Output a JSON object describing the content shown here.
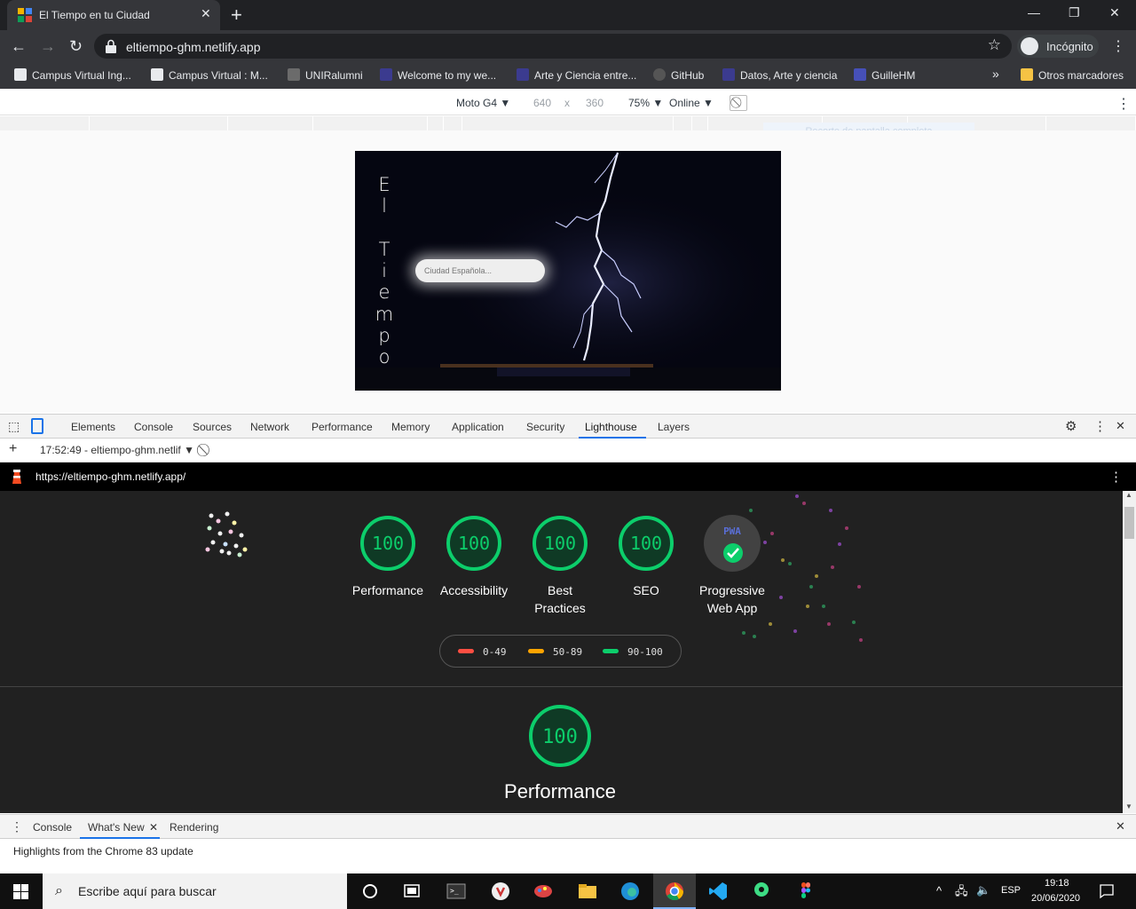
{
  "browser": {
    "tab_title": "El Tiempo en tu Ciudad",
    "url": "eltiempo-ghm.netlify.app",
    "profile_label": "Incógnito",
    "bookmarks": [
      "Campus Virtual Ing...",
      "Campus Virtual : M...",
      "UNIRalumni",
      "Welcome to my we...",
      "Arte y Ciencia entre...",
      "GitHub",
      "Datos, Arte y ciencia",
      "GuilleHM"
    ],
    "other_bookmarks": "Otros marcadores",
    "more_bookmarks": "»"
  },
  "device_toolbar": {
    "device": "Moto G4",
    "width": "640",
    "times": "x",
    "height": "360",
    "zoom": "75%",
    "network": "Online",
    "capture_tooltip": "Recorte de pantalla completa"
  },
  "site": {
    "title_letters": [
      "E",
      "l",
      "",
      "T",
      "i",
      "e",
      "m",
      "p",
      "o"
    ],
    "city_placeholder": "Ciudad Española..."
  },
  "devtools": {
    "tabs": [
      "Elements",
      "Console",
      "Sources",
      "Network",
      "Performance",
      "Memory",
      "Application",
      "Security",
      "Lighthouse",
      "Layers"
    ],
    "active_tab": "Lighthouse",
    "report_selector": "17:52:49 - eltiempo-ghm.netlif",
    "report_url": "https://eltiempo-ghm.netlify.app/"
  },
  "lighthouse": {
    "scores": [
      {
        "label_line1": "Performance",
        "label_line2": "",
        "score": "100"
      },
      {
        "label_line1": "Accessibility",
        "label_line2": "",
        "score": "100"
      },
      {
        "label_line1": "Best",
        "label_line2": "Practices",
        "score": "100"
      },
      {
        "label_line1": "SEO",
        "label_line2": "",
        "score": "100"
      }
    ],
    "pwa": {
      "badge": "PWA",
      "label_line1": "Progressive",
      "label_line2": "Web App"
    },
    "legend": [
      "0-49",
      "50-89",
      "90-100"
    ],
    "colors": {
      "fail": "#ff4e42",
      "average": "#ffa400",
      "pass": "#0cce6b"
    },
    "section_score": "100",
    "section_title": "Performance"
  },
  "drawer": {
    "tabs": [
      "Console",
      "What's New",
      "Rendering"
    ],
    "active_tab": "What's New",
    "message": "Highlights from the Chrome 83 update"
  },
  "taskbar": {
    "search_placeholder": "Escribe aquí para buscar",
    "language": "ESP",
    "time": "19:18",
    "date": "20/06/2020"
  }
}
